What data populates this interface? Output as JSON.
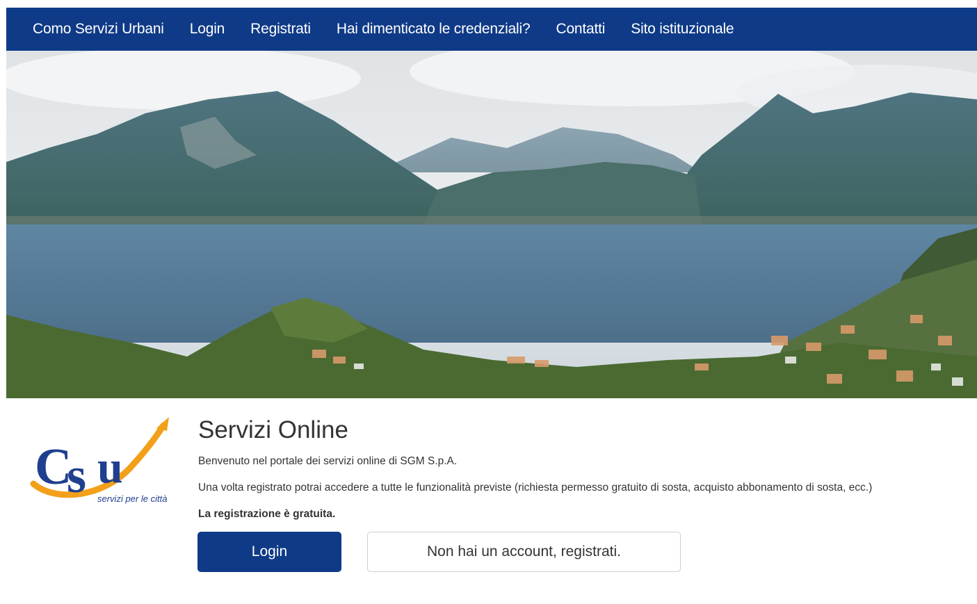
{
  "nav": {
    "items": [
      {
        "label": "Como Servizi Urbani"
      },
      {
        "label": "Login"
      },
      {
        "label": "Registrati"
      },
      {
        "label": "Hai dimenticato le credenziali?"
      },
      {
        "label": "Contatti"
      },
      {
        "label": "Sito istituzionale"
      }
    ]
  },
  "logo": {
    "text": "CSU",
    "tagline": "servizi per le città",
    "colors": {
      "letters": "#1f3f8f",
      "swoosh": "#f2a01a"
    }
  },
  "main": {
    "title": "Servizi Online",
    "welcome": "Benvenuto nel portale dei servizi online di SGM S.p.A.",
    "info": "Una volta registrato potrai accedere a tutte le funzionalità previste (richiesta permesso gratuito di sosta, acquisto abbonamento di sosta, ecc.)",
    "free_note": "La registrazione è gratuita.",
    "login_label": "Login",
    "register_label": "Non hai un account, registrati."
  },
  "colors": {
    "primary": "#0f3a87"
  }
}
